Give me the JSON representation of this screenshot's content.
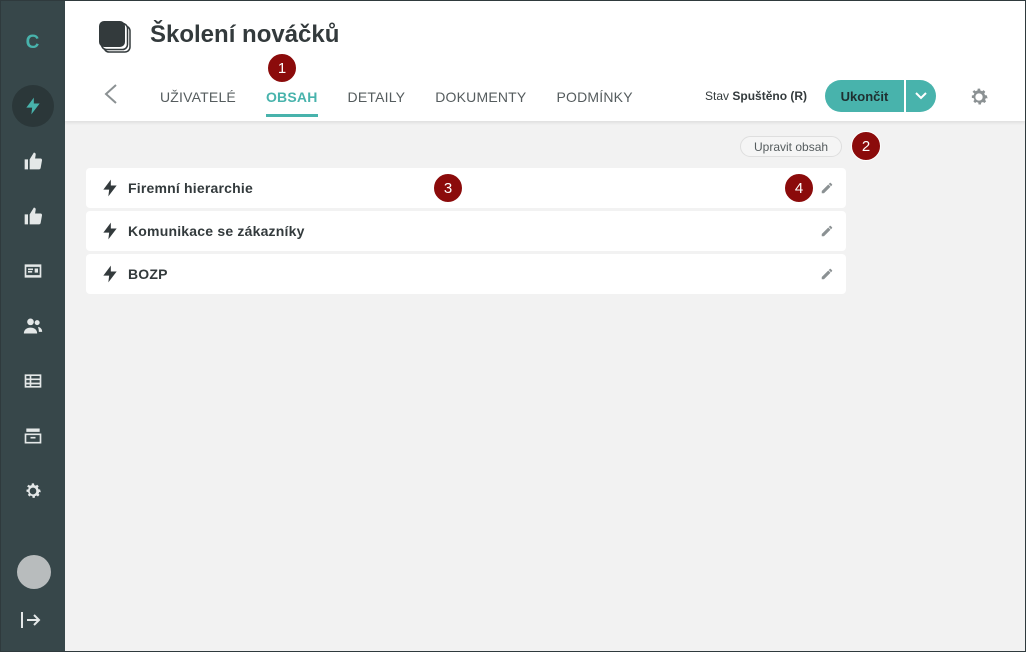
{
  "sidebar": {
    "logo": "C",
    "items": [
      {
        "name": "lightning-icon",
        "active": true
      },
      {
        "name": "thumbs-up-icon"
      },
      {
        "name": "thumbs-up-icon"
      },
      {
        "name": "id-card-icon"
      },
      {
        "name": "users-icon"
      },
      {
        "name": "table-icon"
      },
      {
        "name": "archive-icon"
      },
      {
        "name": "gear-icon"
      }
    ],
    "bottom": [
      "avatar",
      "collapse-icon"
    ]
  },
  "header": {
    "title": "Školení nováčků",
    "tabs": [
      {
        "label": "UŽIVATELÉ",
        "active": false
      },
      {
        "label": "OBSAH",
        "active": true
      },
      {
        "label": "DETAILY",
        "active": false
      },
      {
        "label": "DOKUMENTY",
        "active": false
      },
      {
        "label": "PODMÍNKY",
        "active": false
      }
    ],
    "status_prefix": "Stav",
    "status_value": "Spuštěno (R)",
    "end_button_label": "Ukončit"
  },
  "content": {
    "edit_button_label": "Upravit obsah",
    "items": [
      {
        "label": "Firemní hierarchie"
      },
      {
        "label": "Komunikace se zákazníky"
      },
      {
        "label": "BOZP"
      }
    ]
  },
  "badges": [
    "1",
    "2",
    "3",
    "4"
  ],
  "colors": {
    "accent": "#48b3ac",
    "sidebar_bg": "#37474a",
    "badge": "#8b0b0b",
    "page_bg": "#f2f2f2"
  }
}
